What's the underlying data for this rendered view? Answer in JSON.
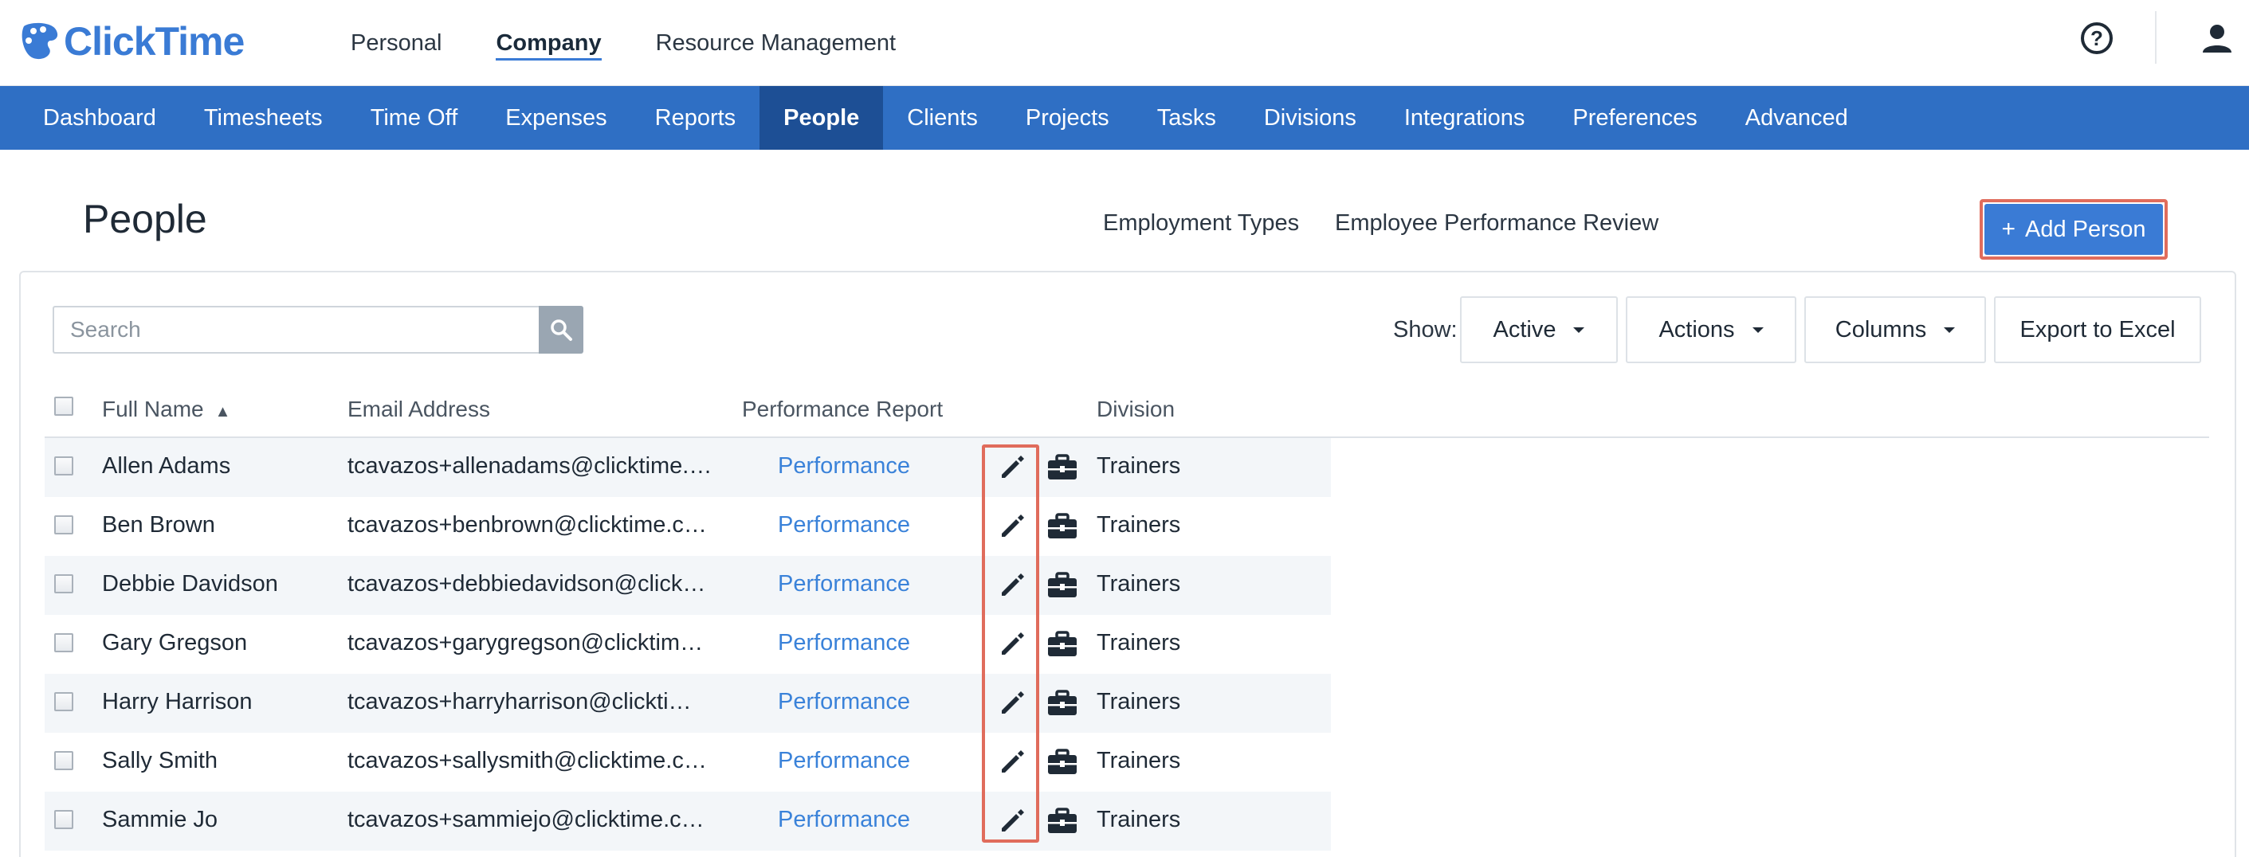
{
  "app": {
    "logo_text": "ClickTime",
    "brand_color": "#3a7bd5",
    "nav_color": "#2f6fc4",
    "nav_active_color": "#1d4f95",
    "highlight_color": "#e06c5c"
  },
  "top_nav": [
    {
      "label": "Personal",
      "active": false
    },
    {
      "label": "Company",
      "active": true
    },
    {
      "label": "Resource Management",
      "active": false
    }
  ],
  "top_icons": {
    "help": "help-circle-icon",
    "help_glyph": "?",
    "user": "user-icon"
  },
  "main_nav": [
    {
      "label": "Dashboard",
      "active": false
    },
    {
      "label": "Timesheets",
      "active": false
    },
    {
      "label": "Time Off",
      "active": false
    },
    {
      "label": "Expenses",
      "active": false
    },
    {
      "label": "Reports",
      "active": false
    },
    {
      "label": "People",
      "active": true
    },
    {
      "label": "Clients",
      "active": false
    },
    {
      "label": "Projects",
      "active": false
    },
    {
      "label": "Tasks",
      "active": false
    },
    {
      "label": "Divisions",
      "active": false
    },
    {
      "label": "Integrations",
      "active": false
    },
    {
      "label": "Preferences",
      "active": false
    },
    {
      "label": "Advanced",
      "active": false
    }
  ],
  "page": {
    "title": "People",
    "links": [
      "Employment Types",
      "Employee Performance Review"
    ],
    "add_button": {
      "plus": "+",
      "label": "Add Person"
    }
  },
  "toolbar": {
    "search_placeholder": "Search",
    "show_label": "Show:",
    "active_filter": "Active",
    "actions_label": "Actions",
    "columns_label": "Columns",
    "export_label": "Export to Excel"
  },
  "table": {
    "headers": {
      "full_name": "Full Name",
      "sort_indicator": "▲",
      "email": "Email Address",
      "performance": "Performance Report",
      "division": "Division"
    },
    "rows": [
      {
        "name": "Allen Adams",
        "email": "tcavazos+allenadams@clicktime.…",
        "performance": "Performance",
        "division": "Trainers"
      },
      {
        "name": "Ben Brown",
        "email": "tcavazos+benbrown@clicktime.c…",
        "performance": "Performance",
        "division": "Trainers"
      },
      {
        "name": "Debbie Davidson",
        "email": "tcavazos+debbiedavidson@click…",
        "performance": "Performance",
        "division": "Trainers"
      },
      {
        "name": "Gary Gregson",
        "email": "tcavazos+garygregson@clicktim…",
        "performance": "Performance",
        "division": "Trainers"
      },
      {
        "name": "Harry Harrison",
        "email": "tcavazos+harryharrison@clickti…",
        "performance": "Performance",
        "division": "Trainers"
      },
      {
        "name": "Sally Smith",
        "email": "tcavazos+sallysmith@clicktime.c…",
        "performance": "Performance",
        "division": "Trainers"
      },
      {
        "name": "Sammie Jo",
        "email": "tcavazos+sammiejo@clicktime.c…",
        "performance": "Performance",
        "division": "Trainers"
      }
    ]
  }
}
